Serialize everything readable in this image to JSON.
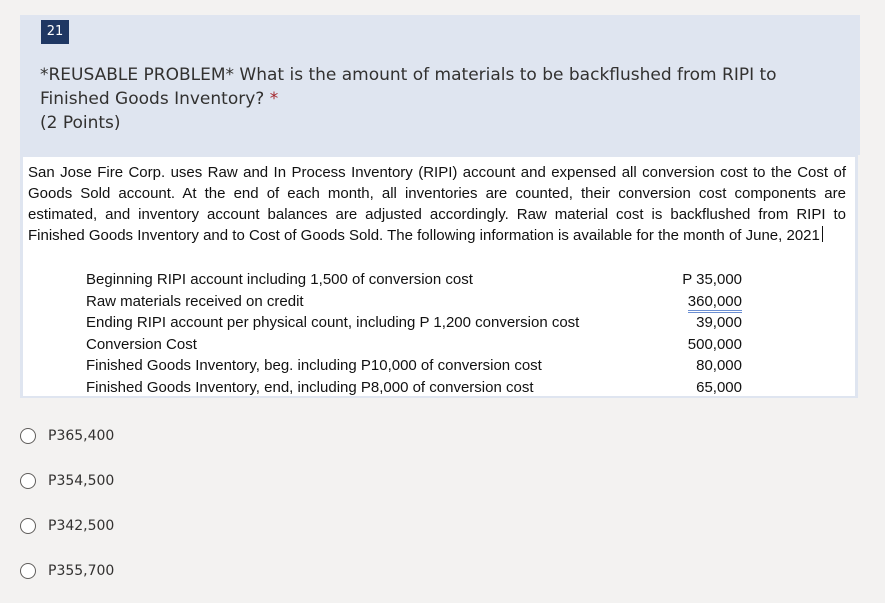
{
  "question": {
    "number": "21",
    "title": "*REUSABLE PROBLEM* What is the amount of materials to be backflushed from RIPI to Finished Goods Inventory?",
    "required_mark": "*",
    "points": "(2 Points)"
  },
  "problem": {
    "text": "San Jose Fire Corp. uses Raw and In Process Inventory (RIPI) account and expensed all conversion cost to the Cost of Goods Sold account.  At the end of each month, all inventories are counted, their conversion cost components are estimated, and inventory account balances are adjusted accordingly.  Raw material cost is backflushed from RIPI to Finished Goods Inventory and to Cost of Goods Sold. The following information is available for the month of June, 2021",
    "rows": [
      {
        "label": "Beginning RIPI account  including 1,500 of conversion cost",
        "value": "P  35,000"
      },
      {
        "label": "Raw materials received on credit",
        "value": "360,000"
      },
      {
        "label": "Ending RIPI  account per physical count, including P 1,200 conversion cost",
        "value": "39,000"
      },
      {
        "label": "Conversion Cost",
        "value": "500,000"
      },
      {
        "label": "Finished Goods Inventory, beg. including P10,000 of conversion cost",
        "value": "80,000"
      },
      {
        "label": "Finished Goods Inventory, end, including  P8,000 of conversion cost",
        "value": "65,000"
      }
    ]
  },
  "options": [
    {
      "label": "P365,400"
    },
    {
      "label": "P354,500"
    },
    {
      "label": "P342,500"
    },
    {
      "label": "P355,700"
    }
  ],
  "colors": {
    "number_badge": "#1f3763",
    "card_background": "#dfe5f0",
    "required": "#a4262c"
  }
}
